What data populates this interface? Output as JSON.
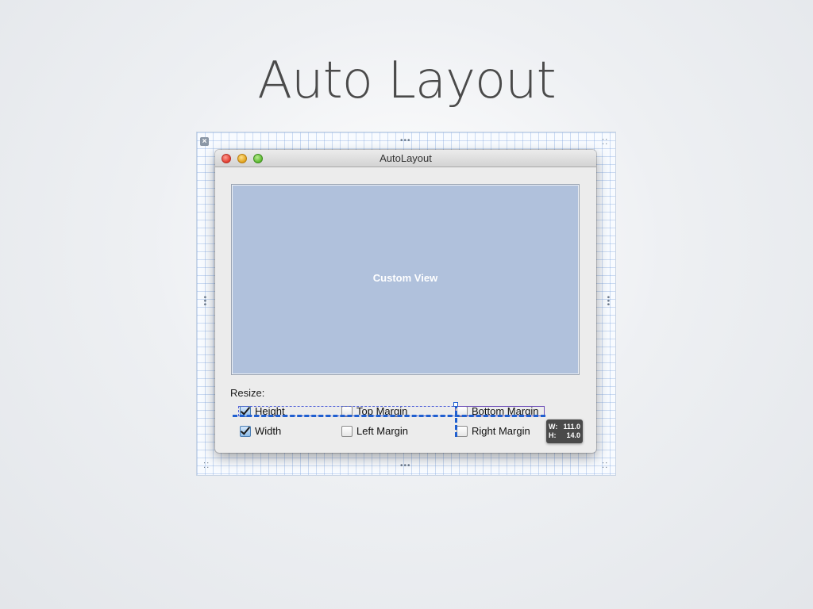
{
  "slide": {
    "title": "Auto Layout"
  },
  "window": {
    "title": "AutoLayout"
  },
  "custom_view": {
    "label": "Custom View"
  },
  "resize": {
    "label": "Resize:",
    "checkboxes": [
      {
        "label": "Height",
        "checked": true
      },
      {
        "label": "Top Margin",
        "checked": false
      },
      {
        "label": "Bottom Margin",
        "checked": false
      },
      {
        "label": "Width",
        "checked": true
      },
      {
        "label": "Left Margin",
        "checked": false
      },
      {
        "label": "Right Margin",
        "checked": false
      }
    ]
  },
  "size_tooltip": {
    "w_label": "W:",
    "w_value": "111.0",
    "h_label": "H:",
    "h_value": "14.0"
  },
  "colors": {
    "custom_view_fill": "#b0c1dc",
    "constraint": "#1f5fd0",
    "title_text": "#4a4a4a"
  }
}
